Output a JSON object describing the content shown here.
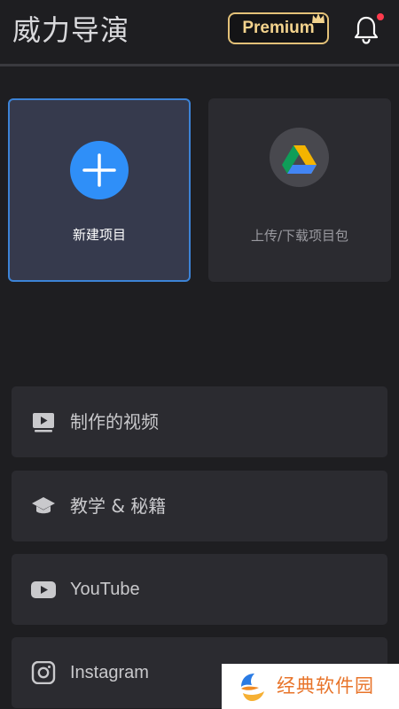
{
  "header": {
    "app_title": "威力导演",
    "premium_label": "Premium",
    "notification_badge_color": "#ff3b4d"
  },
  "cards": [
    {
      "label": "新建项目",
      "icon": "plus-icon"
    },
    {
      "label": "上传/下载项目包",
      "icon": "google-drive-icon"
    }
  ],
  "menu": {
    "items": [
      {
        "label": "制作的视频",
        "icon": "video-library-icon"
      },
      {
        "label": "教学 & 秘籍",
        "icon": "graduation-cap-icon"
      },
      {
        "label": "YouTube",
        "icon": "youtube-icon"
      },
      {
        "label": "Instagram",
        "icon": "instagram-icon"
      }
    ]
  },
  "watermark": {
    "text": "经典软件园"
  },
  "colors": {
    "background": "#1e1e21",
    "accent_blue": "#2f8ff8",
    "premium_gold": "#e3c178"
  }
}
